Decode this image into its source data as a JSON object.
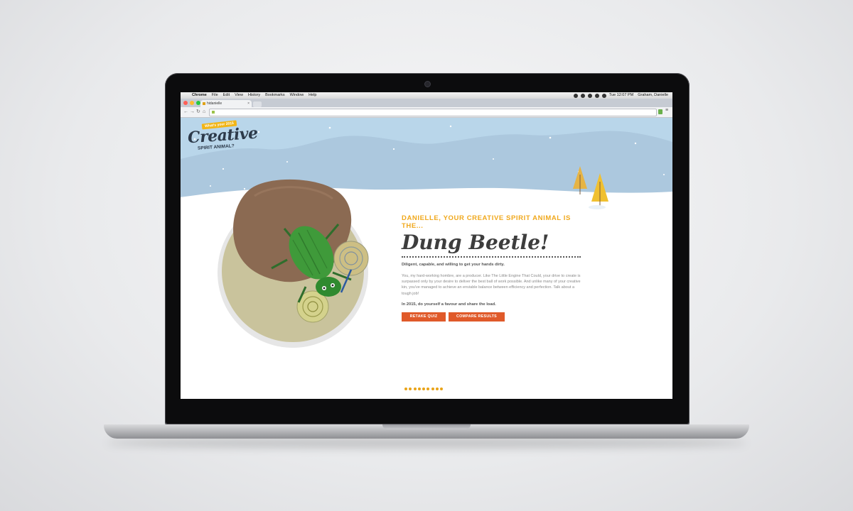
{
  "menubar": {
    "apple": "",
    "items": [
      "Chrome",
      "File",
      "Edit",
      "View",
      "History",
      "Bookmarks",
      "Window",
      "Help"
    ],
    "clock": "Tue 12:07 PM",
    "user": "Graham, Danielle",
    "status_icons": [
      "dropbox-icon",
      "wifi-icon",
      "battery-icon",
      "volume-icon",
      "bluetooth-icon"
    ]
  },
  "browser": {
    "tab_title": "hidanielle",
    "close_glyph": "×",
    "url": "",
    "menu_glyph": "≡",
    "traffic_lights": [
      "#ff5f57",
      "#febc2e",
      "#28c840"
    ]
  },
  "page": {
    "logo": {
      "banner": "What's your 2015",
      "word": "Creative",
      "sub": "SPIRIT ANIMAL?"
    },
    "eyebrow": "DANIELLE, YOUR CREATIVE SPIRIT ANIMAL IS THE...",
    "title": "Dung Beetle!",
    "tagline": "Diligent, capable, and willing to get your hands dirty.",
    "description": "You, my hard-working hombre, are a producer. Like The Little Engine That Could, your drive to create is surpassed only by your desire to deliver the best ball of work possible. And unlike many of your creative kin, you've managed to achieve an enviable balance between efficiency and perfection. Talk about a tough job!",
    "cta": "In 2015, do yourself a favour and share the load.",
    "buttons": {
      "retake": "RETAKE QUIZ",
      "compare": "COMPARE RESULTS"
    },
    "pagination_count": 9,
    "colors": {
      "accent": "#f0a81c",
      "button": "#e05a2a",
      "sky": "#b9d6ea",
      "beetle": "#3f9a3a"
    }
  }
}
